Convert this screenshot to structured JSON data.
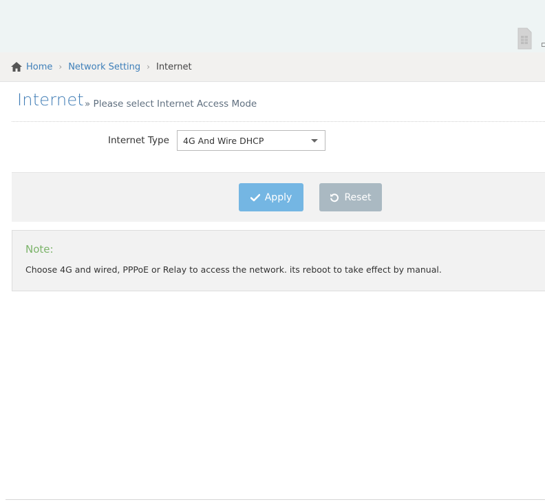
{
  "breadcrumb": {
    "items": [
      "Home",
      "Network Setting",
      "Internet"
    ],
    "separator": "›"
  },
  "page": {
    "title": "Internet",
    "subtitle": "» Please select Internet Access Mode"
  },
  "form": {
    "internet_type_label": "Internet Type",
    "internet_type_value": "4G And Wire DHCP"
  },
  "actions": {
    "apply_label": "Apply",
    "reset_label": "Reset"
  },
  "note": {
    "title": "Note:",
    "text": "Choose 4G and wired, PPPoE or Relay to access the network. its reboot to take effect by manual."
  },
  "colors": {
    "accent_blue": "#3f7cb5",
    "apply_button": "#74b6e3",
    "reset_button": "#aab9c2",
    "note_title": "#7cb46a"
  },
  "icons": [
    "sim-card-icon",
    "home-icon",
    "check-icon",
    "refresh-icon",
    "chevron-down-icon"
  ]
}
